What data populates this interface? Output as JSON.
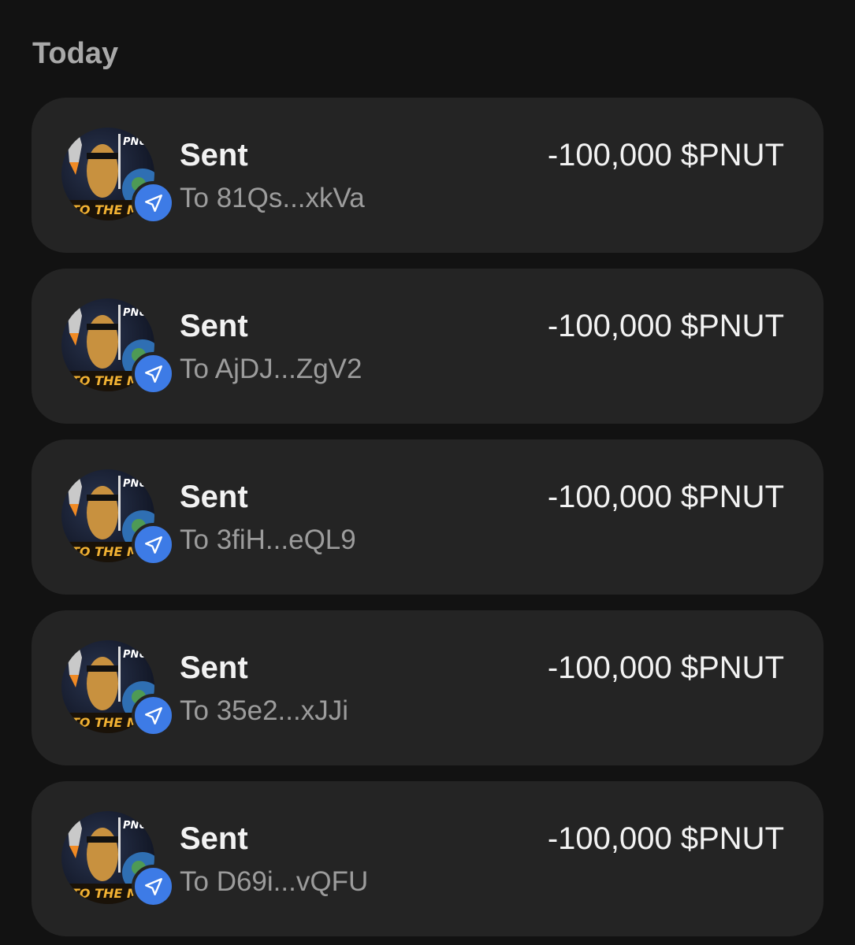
{
  "section": {
    "title": "Today"
  },
  "transactions": [
    {
      "type": "Sent",
      "recipient": "To 81Qs...xkVa",
      "amount": "-100,000 $PNUT",
      "avatar_text": "PNUT CHAOS",
      "avatar_caption": "TO THE M"
    },
    {
      "type": "Sent",
      "recipient": "To AjDJ...ZgV2",
      "amount": "-100,000 $PNUT",
      "avatar_text": "PNUT CHAOS",
      "avatar_caption": "TO THE M"
    },
    {
      "type": "Sent",
      "recipient": "To 3fiH...eQL9",
      "amount": "-100,000 $PNUT",
      "avatar_text": "PNUT CHAOS",
      "avatar_caption": "TO THE M"
    },
    {
      "type": "Sent",
      "recipient": "To 35e2...xJJi",
      "amount": "-100,000 $PNUT",
      "avatar_text": "PNUT CHAOS",
      "avatar_caption": "TO THE M"
    },
    {
      "type": "Sent",
      "recipient": "To D69i...vQFU",
      "amount": "-100,000 $PNUT",
      "avatar_text": "PNUT CHAOS",
      "avatar_caption": "TO THE M"
    }
  ],
  "icons": {
    "avatar": "pnut-token-avatar",
    "badge": "send-arrow-icon"
  },
  "colors": {
    "background": "#121212",
    "card": "#242424",
    "badge": "#3d7be6",
    "title": "#f2f2f2",
    "subtitle": "#9c9c9c"
  }
}
